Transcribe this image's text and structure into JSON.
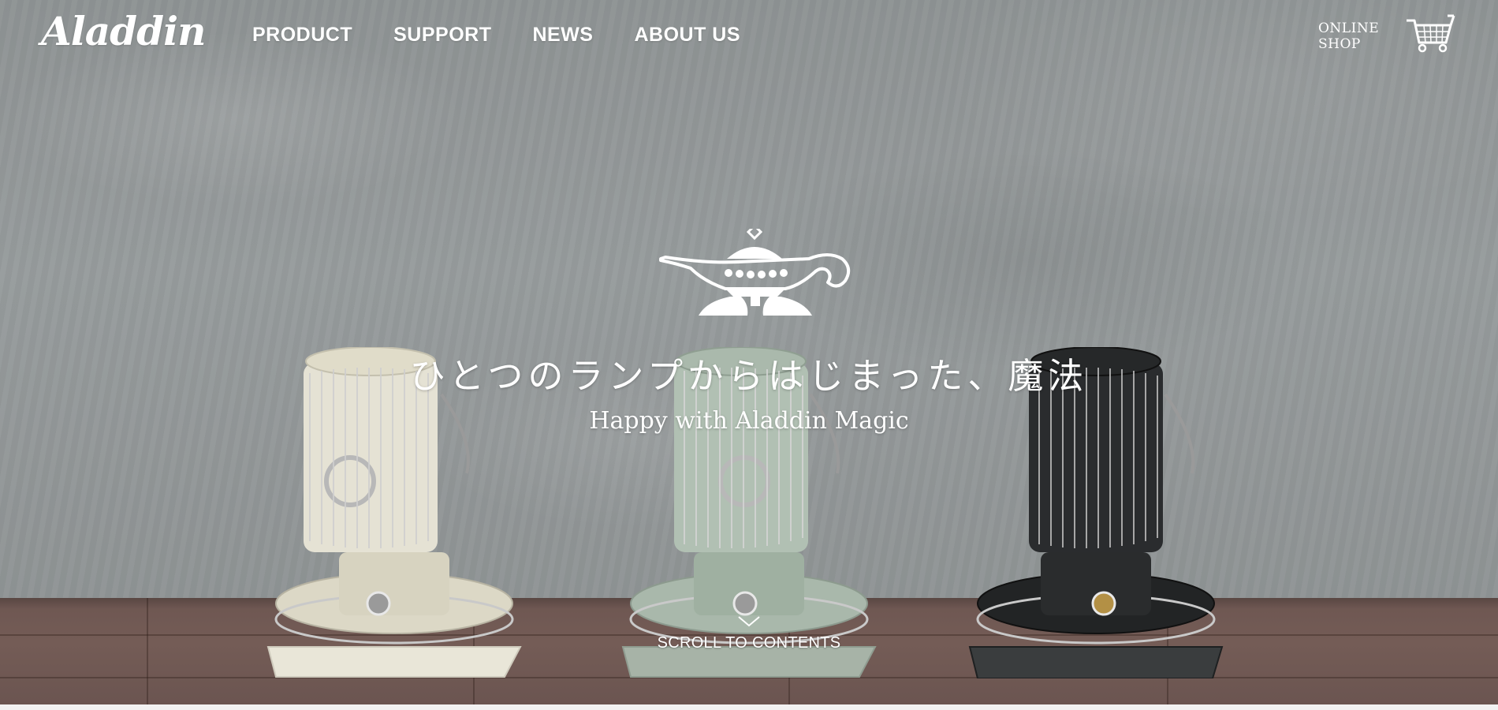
{
  "brand": {
    "logo_text": "Aladdin"
  },
  "nav": {
    "items": [
      {
        "label": "PRODUCT"
      },
      {
        "label": "SUPPORT"
      },
      {
        "label": "NEWS"
      },
      {
        "label": "ABOUT US"
      }
    ]
  },
  "shop": {
    "line1": "ONLINE",
    "line2": "SHOP"
  },
  "hero": {
    "tagline_jp": "ひとつのランプからはじまった、魔法",
    "tagline_en": "Happy with Aladdin Magic",
    "scroll_label": "SCROLL TO CONTENTS"
  },
  "icons": {
    "lamp": "aladdin-lamp-icon",
    "cart": "shopping-cart-icon",
    "scroll": "chevron-down-icon"
  },
  "heaters": [
    {
      "name": "cream-heater",
      "color": "#e4e1d2",
      "accent": "#cfcbb8"
    },
    {
      "name": "sage-heater",
      "color": "#aebdb0",
      "accent": "#98a99a"
    },
    {
      "name": "black-heater",
      "color": "#1f2122",
      "accent": "#333637"
    }
  ],
  "colors": {
    "text": "#ffffff",
    "wall": "#939899",
    "floor": "#6f5853"
  }
}
